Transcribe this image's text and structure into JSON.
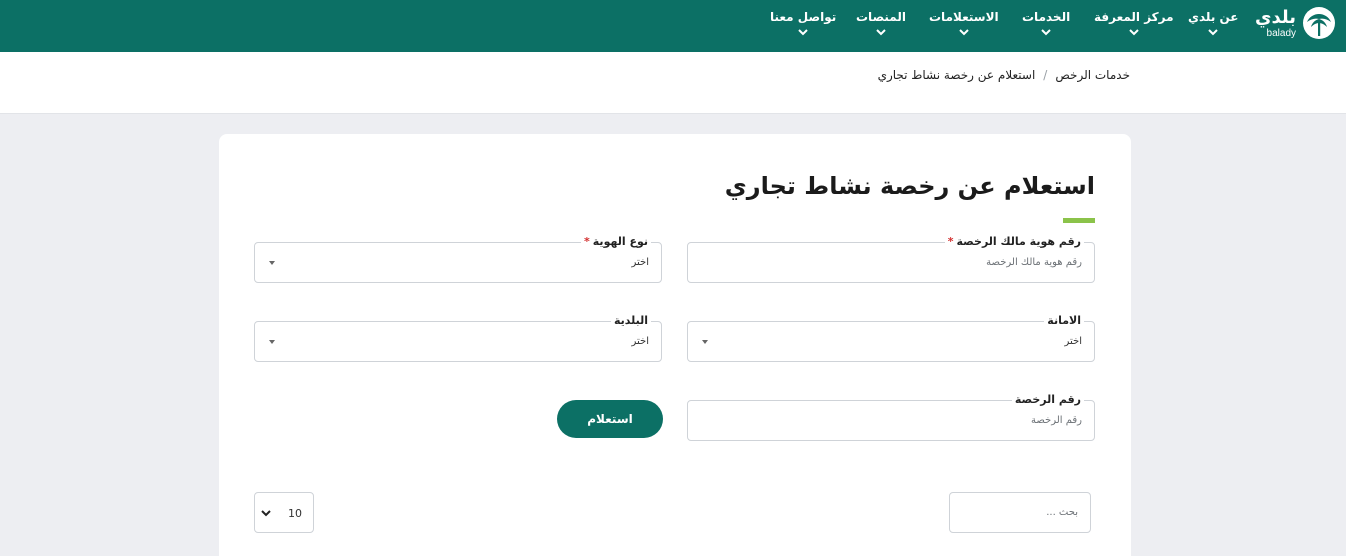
{
  "topnav": {
    "logo_ar": "بلدي",
    "logo_en": "balady",
    "items": [
      {
        "label": "عن بلدي"
      },
      {
        "label": "مركز المعرفة"
      },
      {
        "label": "الخدمات"
      },
      {
        "label": "الاستعلامات"
      },
      {
        "label": "المنصات"
      },
      {
        "label": "تواصل معنا"
      }
    ]
  },
  "breadcrumb": {
    "parent": "خدمات الرخص",
    "separator": "/",
    "current": "استعلام عن رخصة نشاط تجاري"
  },
  "form": {
    "title": "استعلام عن رخصة نشاط تجاري",
    "owner_id": {
      "label": "رقم هوية مالك الرخصة",
      "required_mark": "*",
      "placeholder": "رقم هوية مالك الرخصة"
    },
    "id_type": {
      "label": "نوع الهوية",
      "required_mark": "*",
      "value": "اختر"
    },
    "amana": {
      "label": "الامانة",
      "value": "اختر"
    },
    "municipality": {
      "label": "البلدية",
      "value": "اختر"
    },
    "license_no": {
      "label": "رقم الرخصة",
      "placeholder": "رقم الرخصة"
    },
    "submit_label": "استعلام"
  },
  "table_controls": {
    "search_placeholder": "بحث ...",
    "page_size": "10"
  },
  "colors": {
    "primary": "#0c7065",
    "accent": "#8bc34a",
    "required": "#d32f2f",
    "page_bg": "#edeef2"
  }
}
